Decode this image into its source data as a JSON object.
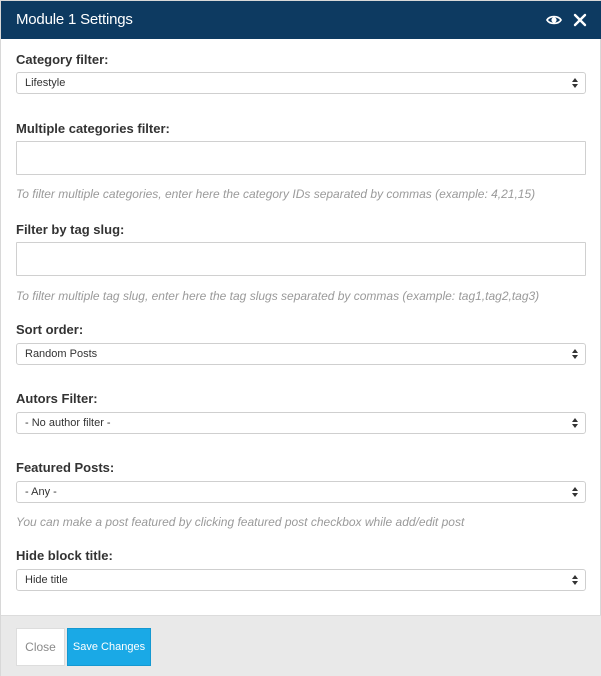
{
  "header": {
    "title": "Module 1 Settings"
  },
  "fields": {
    "category": {
      "label": "Category filter:",
      "value": "Lifestyle"
    },
    "multiple_categories": {
      "label": "Multiple categories filter:",
      "value": "",
      "help": "To filter multiple categories, enter here the category IDs separated by commas (example: 4,21,15)"
    },
    "tag_slug": {
      "label": "Filter by tag slug:",
      "value": "",
      "help": "To filter multiple tag slug, enter here the tag slugs separated by commas (example: tag1,tag2,tag3)"
    },
    "sort_order": {
      "label": "Sort order:",
      "value": "Random Posts"
    },
    "authors": {
      "label": "Autors Filter:",
      "value": "- No author filter -"
    },
    "featured": {
      "label": "Featured Posts:",
      "value": "- Any -",
      "help": "You can make a post featured by clicking featured post checkbox while add/edit post"
    },
    "hide_title": {
      "label": "Hide block title:",
      "value": "Hide title"
    }
  },
  "footer": {
    "close_label": "Close",
    "save_label": "Save Changes"
  },
  "colors": {
    "header_bg": "#0d3a61",
    "save_button": "#1aa9e6",
    "footer_bg": "#e9e9e9"
  }
}
